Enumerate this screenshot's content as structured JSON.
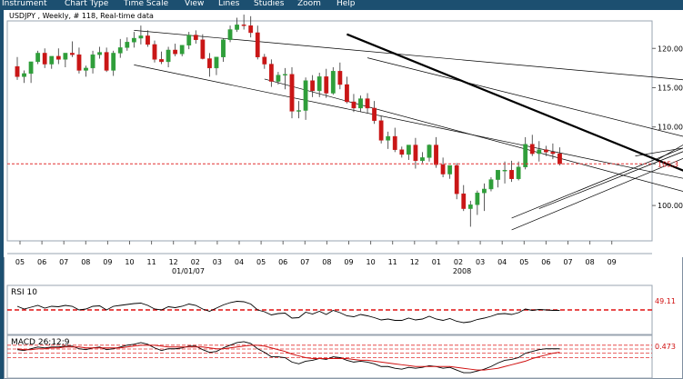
{
  "menu": {
    "items": [
      "Instrument",
      "Chart Type",
      "Time Scale",
      "View",
      "Lines",
      "Studies",
      "Zoom",
      "Help"
    ]
  },
  "chart_header": "USDJPY , Weekly, # 118, Real-time data",
  "colors": {
    "menubar_bg": "#1c4f70",
    "bull_candle": "#2f9e3a",
    "bear_candle": "#c91616",
    "reference_line": "#e23030",
    "macd_signal": "#d01010"
  },
  "rsi_panel": {
    "title": "RSI 10",
    "current_value": "49.11"
  },
  "macd_panel": {
    "title": "MACD 26;12;9",
    "current_value": "0.473"
  },
  "chart_data": {
    "type": "candlestick",
    "title": "USDJPY , Weekly, # 118, Real-time data",
    "price_axis_labels": [
      "120.00",
      "115.00",
      "110.00",
      "105.3",
      "100.00"
    ],
    "current_price_label": "105.3",
    "reference_price": 105.3,
    "ylim": [
      95.5,
      123.5
    ],
    "x_tick_labels": [
      "05",
      "06",
      "07",
      "08",
      "09",
      "10",
      "11",
      "12",
      "02",
      "03",
      "04",
      "05",
      "06",
      "07",
      "08",
      "09",
      "10",
      "11",
      "12",
      "01",
      "02",
      "03",
      "04",
      "05",
      "06",
      "07",
      "08",
      "09"
    ],
    "x_axis_dates": [
      "01/01/07",
      "2008"
    ],
    "candles": {
      "open": [
        117.7,
        116.4,
        116.8,
        118.3,
        119.4,
        118.0,
        119.0,
        118.6,
        119.4,
        119.2,
        117.2,
        117.5,
        119.2,
        119.5,
        117.2,
        119.4,
        120.1,
        120.8,
        121.3,
        121.6,
        120.5,
        118.6,
        118.3,
        119.8,
        119.3,
        120.4,
        121.7,
        121.1,
        118.7,
        117.5,
        118.9,
        121.1,
        122.4,
        123.0,
        122.9,
        122.0,
        118.9,
        118.0,
        115.8,
        116.6,
        116.7,
        112.0,
        112.1,
        115.9,
        114.6,
        116.4,
        114.3,
        117.1,
        115.4,
        113.2,
        112.4,
        113.6,
        112.4,
        110.8,
        108.3,
        108.8,
        107.1,
        106.5,
        107.7,
        105.7,
        106.1,
        107.7,
        105.2,
        104.0,
        105.1,
        101.5,
        99.6,
        100.1,
        101.6,
        102.1,
        103.3,
        104.5,
        104.5,
        103.4,
        104.9,
        107.8,
        106.6,
        107.1,
        106.8,
        106.6
      ],
      "high": [
        118.9,
        117.2,
        118.2,
        119.7,
        120.0,
        118.7,
        120.0,
        119.4,
        120.9,
        120.1,
        117.8,
        119.7,
        120.2,
        120.1,
        119.7,
        121.2,
        121.4,
        122.1,
        122.9,
        122.3,
        121.0,
        119.6,
        120.2,
        120.6,
        120.4,
        122.1,
        122.3,
        121.8,
        119.4,
        118.9,
        121.3,
        122.9,
        123.9,
        124.3,
        124.1,
        122.9,
        119.3,
        118.6,
        117.0,
        117.5,
        117.6,
        113.3,
        116.3,
        116.6,
        116.9,
        117.4,
        117.6,
        118.2,
        116.4,
        114.2,
        114.0,
        114.3,
        113.3,
        111.4,
        109.4,
        109.9,
        107.5,
        107.5,
        108.6,
        106.8,
        107.8,
        108.7,
        106.1,
        104.7,
        105.4,
        102.6,
        100.6,
        101.9,
        102.8,
        103.6,
        104.5,
        105.6,
        105.7,
        105.6,
        108.7,
        109.0,
        108.2,
        107.6,
        107.9,
        107.4
      ],
      "low": [
        116.0,
        115.6,
        115.6,
        118.0,
        117.5,
        117.4,
        118.0,
        117.6,
        118.9,
        116.8,
        116.4,
        116.8,
        118.7,
        117.0,
        116.5,
        118.8,
        119.7,
        120.1,
        120.5,
        120.2,
        118.2,
        118.0,
        117.6,
        119.0,
        119.0,
        119.9,
        120.6,
        118.6,
        116.4,
        116.6,
        118.3,
        120.8,
        122.1,
        122.4,
        121.4,
        118.6,
        117.4,
        115.1,
        115.4,
        114.8,
        111.1,
        111.1,
        110.9,
        113.8,
        113.8,
        113.7,
        114.1,
        114.8,
        113.0,
        111.9,
        111.9,
        111.7,
        110.4,
        107.9,
        107.2,
        106.8,
        106.1,
        105.8,
        104.7,
        105.4,
        105.6,
        104.8,
        103.6,
        103.4,
        100.8,
        99.3,
        97.3,
        98.8,
        99.3,
        101.8,
        102.3,
        102.8,
        103.0,
        103.2,
        104.6,
        106.3,
        105.6,
        106.3,
        105.9,
        105.1
      ],
      "close": [
        116.4,
        116.8,
        118.3,
        119.4,
        118.0,
        119.0,
        118.6,
        119.4,
        119.2,
        117.2,
        117.5,
        119.2,
        119.5,
        117.2,
        119.4,
        120.1,
        120.8,
        121.3,
        121.6,
        120.5,
        118.6,
        118.3,
        119.8,
        119.3,
        120.4,
        121.7,
        121.1,
        118.7,
        117.5,
        118.9,
        121.1,
        122.4,
        123.0,
        122.9,
        122.0,
        118.9,
        118.0,
        115.8,
        116.6,
        116.7,
        112.0,
        112.1,
        115.9,
        114.6,
        116.4,
        114.3,
        117.1,
        115.4,
        113.2,
        112.4,
        113.6,
        112.4,
        110.8,
        108.3,
        108.8,
        107.1,
        106.5,
        107.7,
        105.7,
        106.1,
        107.7,
        105.2,
        104.0,
        105.1,
        101.5,
        99.6,
        100.1,
        101.6,
        102.1,
        103.3,
        104.5,
        104.5,
        103.4,
        104.9,
        107.8,
        106.6,
        107.1,
        106.8,
        106.6,
        105.3
      ]
    },
    "rsi": [
      58,
      52,
      56,
      60,
      54,
      58,
      57,
      60,
      58,
      50,
      52,
      58,
      59,
      50,
      58,
      60,
      62,
      64,
      65,
      60,
      52,
      50,
      57,
      55,
      58,
      63,
      60,
      52,
      47,
      54,
      61,
      66,
      69,
      68,
      63,
      50,
      46,
      39,
      42,
      43,
      32,
      33,
      45,
      41,
      47,
      40,
      49,
      44,
      37,
      35,
      40,
      37,
      33,
      28,
      30,
      27,
      27,
      32,
      28,
      30,
      36,
      30,
      27,
      31,
      25,
      22,
      24,
      29,
      32,
      36,
      41,
      42,
      40,
      44,
      52,
      49,
      51,
      50,
      49,
      49
    ],
    "rsi_reference": 50,
    "macd": [
      0.4,
      0.3,
      0.5,
      0.7,
      0.6,
      0.7,
      0.7,
      0.8,
      0.8,
      0.5,
      0.4,
      0.6,
      0.7,
      0.4,
      0.5,
      0.7,
      0.9,
      1.0,
      1.2,
      1.0,
      0.6,
      0.3,
      0.5,
      0.5,
      0.6,
      0.8,
      0.8,
      0.4,
      0.1,
      0.2,
      0.6,
      0.9,
      1.2,
      1.3,
      1.1,
      0.5,
      0.1,
      -0.4,
      -0.4,
      -0.5,
      -1.0,
      -1.2,
      -0.9,
      -0.8,
      -0.6,
      -0.7,
      -0.4,
      -0.5,
      -0.8,
      -1.0,
      -0.9,
      -1.0,
      -1.2,
      -1.5,
      -1.5,
      -1.7,
      -1.8,
      -1.6,
      -1.7,
      -1.6,
      -1.4,
      -1.5,
      -1.7,
      -1.6,
      -1.9,
      -2.2,
      -2.2,
      -2.0,
      -1.8,
      -1.5,
      -1.1,
      -0.8,
      -0.7,
      -0.5,
      0.0,
      0.2,
      0.4,
      0.5,
      0.5,
      0.5
    ],
    "macd_signal": [
      0.5,
      0.4,
      0.4,
      0.5,
      0.5,
      0.6,
      0.6,
      0.7,
      0.7,
      0.7,
      0.6,
      0.6,
      0.6,
      0.6,
      0.6,
      0.6,
      0.7,
      0.8,
      0.9,
      0.9,
      0.9,
      0.8,
      0.7,
      0.7,
      0.7,
      0.7,
      0.7,
      0.7,
      0.6,
      0.5,
      0.5,
      0.6,
      0.7,
      0.8,
      0.9,
      0.9,
      0.8,
      0.6,
      0.4,
      0.2,
      -0.1,
      -0.3,
      -0.5,
      -0.6,
      -0.6,
      -0.6,
      -0.6,
      -0.6,
      -0.6,
      -0.7,
      -0.8,
      -0.8,
      -0.9,
      -1.0,
      -1.1,
      -1.2,
      -1.3,
      -1.4,
      -1.5,
      -1.5,
      -1.5,
      -1.5,
      -1.5,
      -1.5,
      -1.6,
      -1.7,
      -1.8,
      -1.9,
      -1.9,
      -1.8,
      -1.7,
      -1.5,
      -1.3,
      -1.1,
      -0.9,
      -0.6,
      -0.4,
      -0.2,
      0.0,
      0.1
    ],
    "macd_reference_levels": [
      0.9,
      0.473,
      0.0,
      -0.5
    ],
    "trend_lines": [
      {
        "name": "line-a",
        "from": [
          48,
          121.8
        ],
        "to": [
          120,
          96.3
        ]
      },
      {
        "name": "line-b",
        "from": [
          51,
          118.8
        ],
        "to": [
          120,
          103.8
        ]
      },
      {
        "name": "line-c",
        "from": [
          17,
          122.3
        ],
        "to": [
          120,
          114.2
        ]
      },
      {
        "name": "line-d",
        "from": [
          17,
          117.9
        ],
        "to": [
          120,
          99.3
        ]
      },
      {
        "name": "line-e",
        "from": [
          36,
          116.1
        ],
        "to": [
          120,
          96.4
        ]
      },
      {
        "name": "line-f",
        "from": [
          72,
          96.9
        ],
        "to": [
          119,
          114.0
        ]
      },
      {
        "name": "line-g",
        "from": [
          76,
          99.6
        ],
        "to": [
          119,
          114.5
        ]
      },
      {
        "name": "line-h",
        "from": [
          72,
          98.4
        ],
        "to": [
          119,
          115.2
        ]
      },
      {
        "name": "line-i",
        "from": [
          90,
          106.3
        ],
        "to": [
          119,
          110.5
        ]
      },
      {
        "name": "line-j",
        "from": [
          93,
          105.7
        ],
        "to": [
          117,
          117.9
        ]
      }
    ],
    "arrows": [
      {
        "name": "arrow-up",
        "from": [
          104,
          104.1
        ],
        "to": [
          115,
          113.5
        ]
      },
      {
        "name": "arrow-down",
        "from": [
          115,
          113.4
        ],
        "to": [
          122,
          97.3
        ]
      }
    ]
  }
}
